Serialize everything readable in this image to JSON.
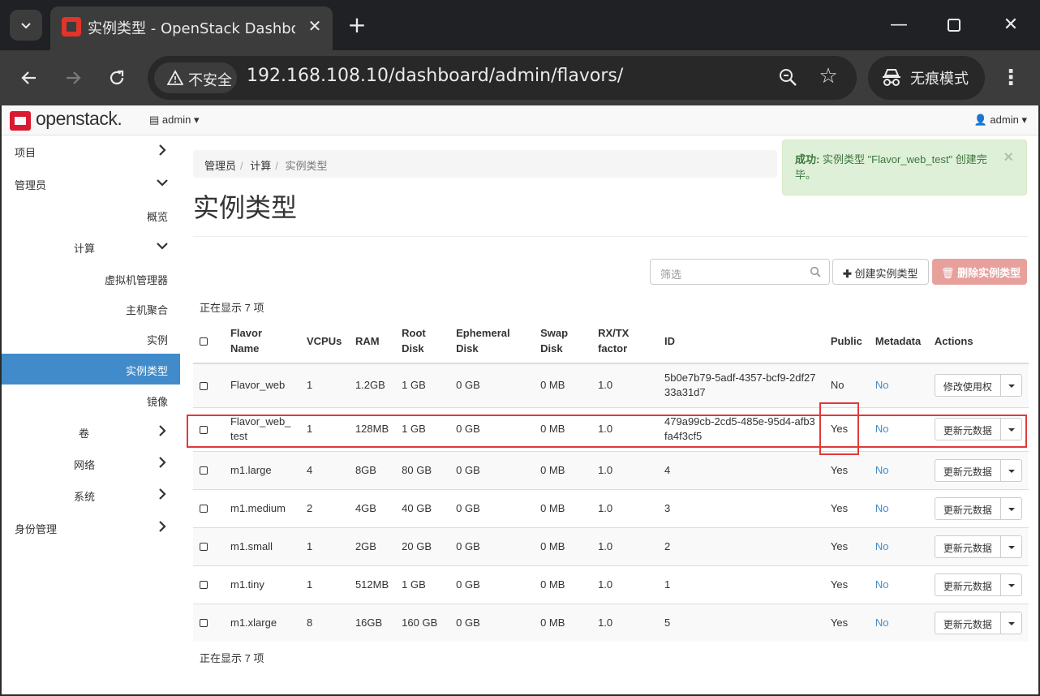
{
  "browser": {
    "tab_title": "实例类型 - OpenStack Dashboard",
    "new_tab_label": "+",
    "insecure_label": "不安全",
    "url": "192.168.108.10/dashboard/admin/flavors/",
    "incognito_label": "无痕模式"
  },
  "header": {
    "logo_text": "openstack.",
    "project_menu": "admin",
    "user_menu": "admin"
  },
  "sidebar": {
    "items": [
      {
        "label": "项目"
      },
      {
        "label": "管理员"
      },
      {
        "label": "概览"
      },
      {
        "label": "计算"
      },
      {
        "label": "虚拟机管理器"
      },
      {
        "label": "主机聚合"
      },
      {
        "label": "实例"
      },
      {
        "label": "实例类型"
      },
      {
        "label": "镜像"
      },
      {
        "label": "卷"
      },
      {
        "label": "网络"
      },
      {
        "label": "系统"
      },
      {
        "label": "身份管理"
      }
    ]
  },
  "breadcrumb": [
    "管理员",
    "计算",
    "实例类型"
  ],
  "page_title": "实例类型",
  "alert": {
    "prefix": "成功:",
    "message": " 实例类型 \"Flavor_web_test\" 创建完毕。",
    "close": "×"
  },
  "filter": {
    "placeholder": "筛选"
  },
  "buttons": {
    "create": "创建实例类型",
    "delete": "删除实例类型"
  },
  "count_text": "正在显示 7 项",
  "table": {
    "headers": [
      "Flavor Name",
      "VCPUs",
      "RAM",
      "Root Disk",
      "Ephemeral Disk",
      "Swap Disk",
      "RX/TX factor",
      "ID",
      "Public",
      "Metadata",
      "Actions"
    ],
    "rows": [
      {
        "name": "Flavor_web",
        "vcpus": "1",
        "ram": "1.2GB",
        "root": "1 GB",
        "eph": "0 GB",
        "swap": "0 MB",
        "rxtx": "1.0",
        "id": "5b0e7b79-5adf-4357-bcf9-2df2733a31d7",
        "public": "No",
        "metadata": "No",
        "action": "修改使用权"
      },
      {
        "name": "Flavor_web_test",
        "vcpus": "1",
        "ram": "128MB",
        "root": "1 GB",
        "eph": "0 GB",
        "swap": "0 MB",
        "rxtx": "1.0",
        "id": "479a99cb-2cd5-485e-95d4-afb3fa4f3cf5",
        "public": "Yes",
        "metadata": "No",
        "action": "更新元数据"
      },
      {
        "name": "m1.large",
        "vcpus": "4",
        "ram": "8GB",
        "root": "80 GB",
        "eph": "0 GB",
        "swap": "0 MB",
        "rxtx": "1.0",
        "id": "4",
        "public": "Yes",
        "metadata": "No",
        "action": "更新元数据"
      },
      {
        "name": "m1.medium",
        "vcpus": "2",
        "ram": "4GB",
        "root": "40 GB",
        "eph": "0 GB",
        "swap": "0 MB",
        "rxtx": "1.0",
        "id": "3",
        "public": "Yes",
        "metadata": "No",
        "action": "更新元数据"
      },
      {
        "name": "m1.small",
        "vcpus": "1",
        "ram": "2GB",
        "root": "20 GB",
        "eph": "0 GB",
        "swap": "0 MB",
        "rxtx": "1.0",
        "id": "2",
        "public": "Yes",
        "metadata": "No",
        "action": "更新元数据"
      },
      {
        "name": "m1.tiny",
        "vcpus": "1",
        "ram": "512MB",
        "root": "1 GB",
        "eph": "0 GB",
        "swap": "0 MB",
        "rxtx": "1.0",
        "id": "1",
        "public": "Yes",
        "metadata": "No",
        "action": "更新元数据"
      },
      {
        "name": "m1.xlarge",
        "vcpus": "8",
        "ram": "16GB",
        "root": "160 GB",
        "eph": "0 GB",
        "swap": "0 MB",
        "rxtx": "1.0",
        "id": "5",
        "public": "Yes",
        "metadata": "No",
        "action": "更新元数据"
      }
    ]
  },
  "colors": {
    "active_nav": "#428bca",
    "link": "#428bca",
    "alert_bg": "#dff0d8",
    "danger_btn": "#e8a09c",
    "highlight": "#e03a3a",
    "brand": "#da1a32"
  }
}
